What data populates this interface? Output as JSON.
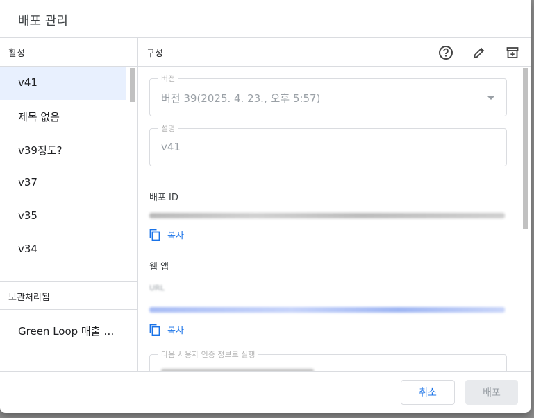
{
  "dialog": {
    "title": "배포 관리"
  },
  "left": {
    "active_header": "활성",
    "versions": [
      {
        "label": "v41",
        "selected": true
      },
      {
        "label": "제목 없음"
      },
      {
        "label": "v39정도?"
      },
      {
        "label": "v37"
      },
      {
        "label": "v35"
      },
      {
        "label": "v34"
      }
    ],
    "archived_header": "보관처리됨",
    "archived": [
      {
        "label": "Green Loop 매출 관..."
      }
    ]
  },
  "right": {
    "header": "구성",
    "icons": [
      "help-icon",
      "edit-icon",
      "archive-icon"
    ],
    "version_field": {
      "label": "버전",
      "value": "버전 39(2025. 4. 23., 오후 5:57)"
    },
    "description_field": {
      "label": "설명",
      "value": "v41"
    },
    "deployment_id_label": "배포 ID",
    "copy_label": "복사",
    "webapp_label": "웹 앱",
    "url_label": "URL",
    "execute_as_field": {
      "label": "다음 사용자 인증 정보로 실행"
    }
  },
  "footer": {
    "cancel": "취소",
    "deploy": "배포"
  },
  "colors": {
    "accent": "#1a73e8",
    "selected_bg": "#e8f0fe",
    "border": "#dadce0"
  }
}
